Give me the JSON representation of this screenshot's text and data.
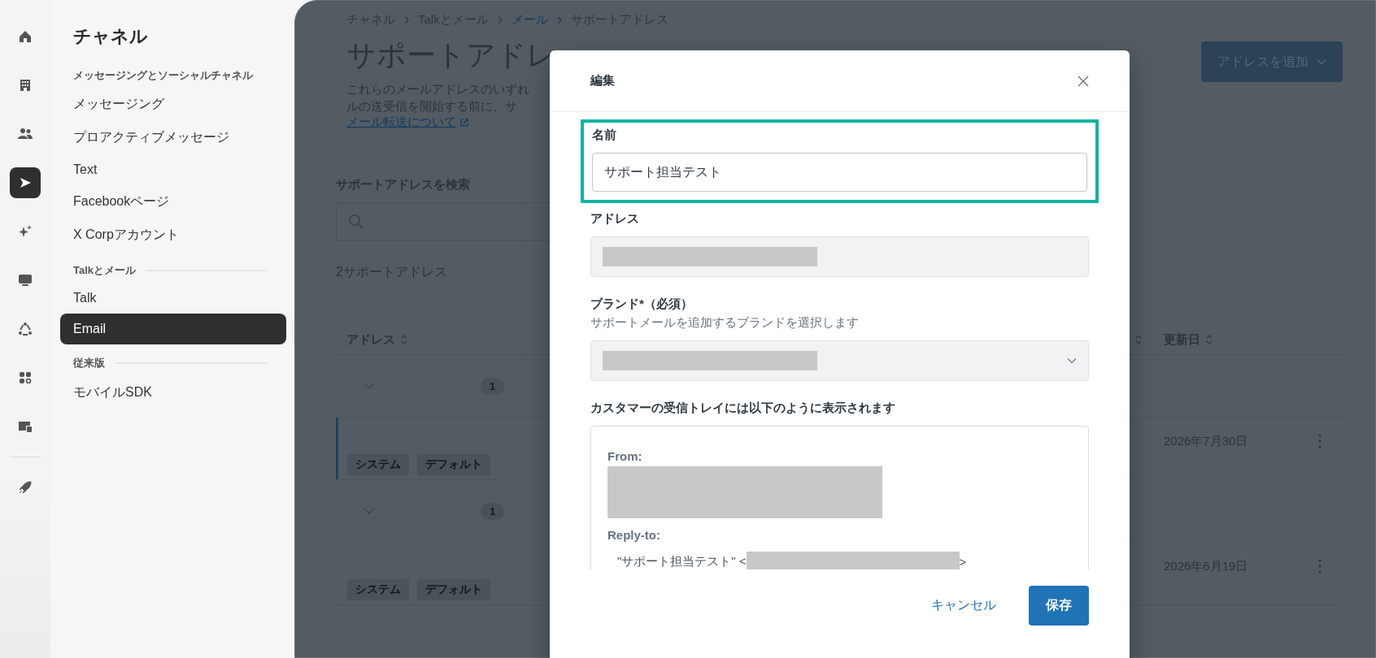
{
  "icon_rail": {
    "items": [
      {
        "kind": "home",
        "selected": false
      },
      {
        "kind": "building",
        "selected": false
      },
      {
        "kind": "people",
        "selected": false
      },
      {
        "kind": "send",
        "selected": true
      },
      {
        "kind": "sparkle",
        "selected": false
      },
      {
        "kind": "monitor",
        "selected": false
      },
      {
        "kind": "cycle",
        "selected": false
      },
      {
        "kind": "apps",
        "selected": false
      },
      {
        "kind": "device",
        "selected": false
      },
      {
        "kind": "rocket",
        "selected": false
      }
    ]
  },
  "sidebar": {
    "title": "チャネル",
    "sections": [
      {
        "heading": "メッセージングとソーシャルチャネル",
        "ruled": false,
        "items": [
          {
            "label": "メッセージング",
            "selected": false
          },
          {
            "label": "プロアクティブメッセージ",
            "selected": false
          },
          {
            "label": "Text",
            "selected": false
          },
          {
            "label": "Facebookページ",
            "selected": false
          },
          {
            "label": "X Corpアカウント",
            "selected": false
          }
        ]
      },
      {
        "heading": "Talkとメール",
        "ruled": true,
        "items": [
          {
            "label": "Talk",
            "selected": false
          },
          {
            "label": "Email",
            "selected": true
          }
        ]
      },
      {
        "heading": "従来版",
        "ruled": true,
        "items": [
          {
            "label": "モバイルSDK",
            "selected": false
          }
        ]
      }
    ]
  },
  "main": {
    "breadcrumb": [
      {
        "label": "チャネル",
        "link": false
      },
      {
        "label": "Talkとメール",
        "link": false
      },
      {
        "label": "メール",
        "link": true
      },
      {
        "label": "サポートアドレス",
        "link": false
      }
    ],
    "title": "サポートアドレ",
    "description_lines": [
      "これらのメールアドレスのいずれ",
      "ルの送受信を開始する前に、サ"
    ],
    "help_link": "メール転送について",
    "add_button": "アドレスを追加",
    "search_label": "サポートアドレスを検索",
    "count": "2サポートアドレス",
    "table": {
      "columns": [
        "アドレス",
        "更新日"
      ],
      "rows": [
        {
          "kind": "group",
          "badge": "1",
          "selected": false
        },
        {
          "kind": "address",
          "tags": [
            "システム",
            "デフォルト"
          ],
          "date": "2026年7月30日",
          "selected": true
        },
        {
          "kind": "group",
          "badge": "1",
          "selected": false
        },
        {
          "kind": "address",
          "tags": [
            "システム",
            "デフォルト"
          ],
          "date": "2026年6月19日",
          "selected": false
        }
      ]
    }
  },
  "dialog": {
    "title": "編集",
    "name_label": "名前",
    "name_value": "サポート担当テスト",
    "address_label": "アドレス",
    "brand_label": "ブランド*（必須）",
    "brand_hint": "サポートメールを追加するブランドを選択します",
    "preview_label": "カスタマーの受信トレイには以下のように表示されます",
    "preview": {
      "from_label": "From:",
      "reply_label": "Reply-to:",
      "reply_name": "\"サポート担当テスト\" <",
      "reply_end": ">"
    },
    "cancel": "キャンセル",
    "save": "保存"
  }
}
